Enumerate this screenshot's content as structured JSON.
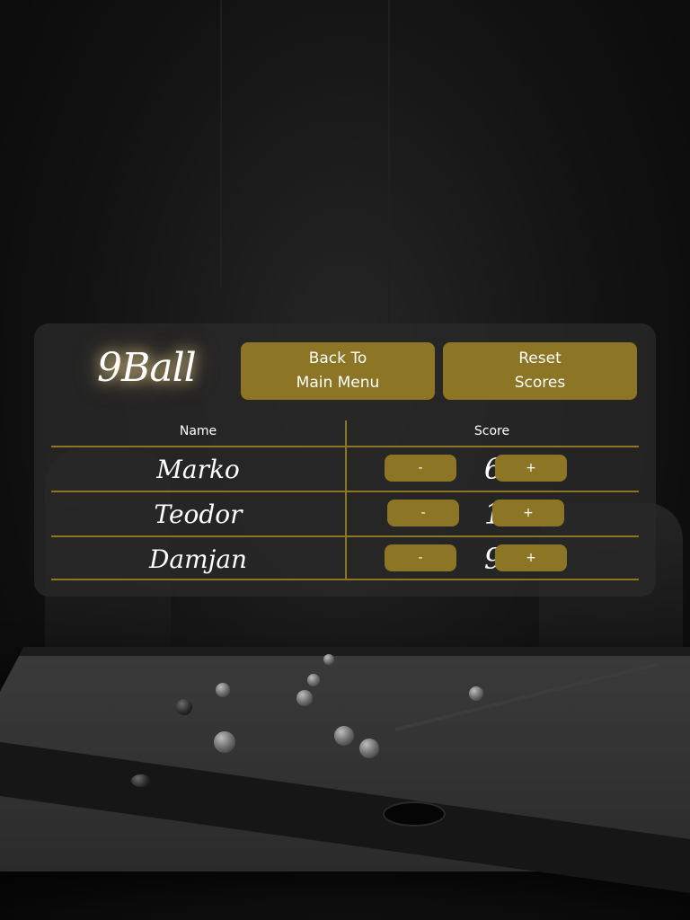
{
  "header": {
    "logo_number": "9",
    "logo_word": "Ball",
    "back_button": {
      "line1": "Back To",
      "line2": "Main Menu"
    },
    "reset_button": {
      "line1": "Reset",
      "line2": "Scores"
    }
  },
  "scoreboard": {
    "name_header": "Name",
    "score_header": "Score",
    "decrement_label": "-",
    "increment_label": "+",
    "players": [
      {
        "name": "Marko",
        "score": "6"
      },
      {
        "name": "Teodor",
        "score": "1"
      },
      {
        "name": "Damjan",
        "score": "9"
      }
    ]
  },
  "colors": {
    "accent_gold": "#8c7524",
    "panel_bg": "rgba(40,40,40,0.82)",
    "text": "#ffffff"
  }
}
